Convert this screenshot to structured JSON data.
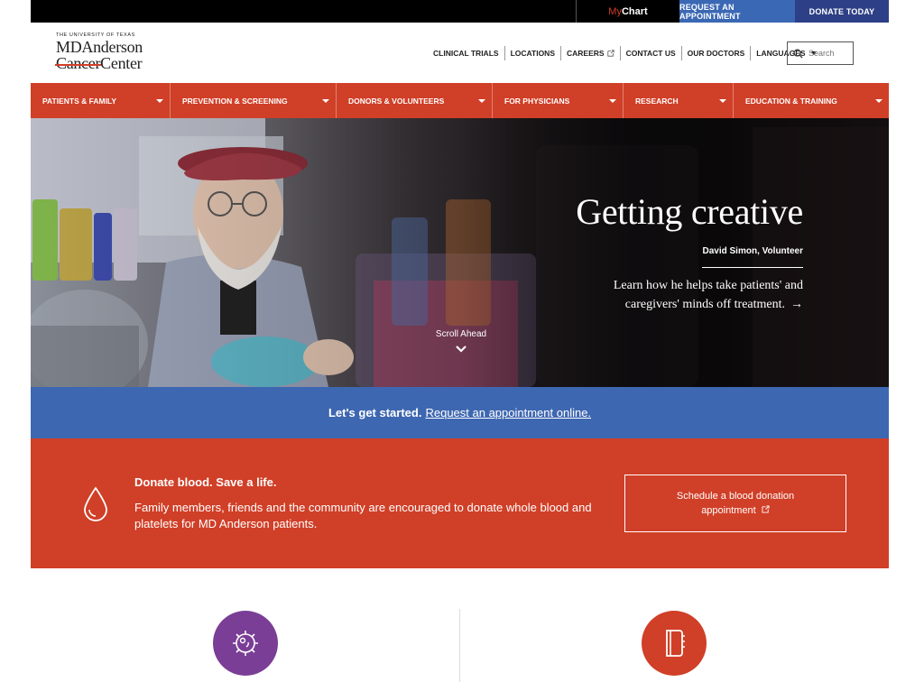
{
  "utility_bar": {
    "mychart_prefix": "My",
    "mychart_label": "Chart",
    "request_label": "REQUEST AN APPOINTMENT",
    "donate_label": "DONATE TODAY",
    "colors": {
      "bar": "#000000",
      "request": "#3b68b4",
      "donate": "#2d3f86"
    }
  },
  "logo": {
    "university": "THE UNIVERSITY OF TEXAS",
    "line1": "MDAnderson",
    "line2_struck": "Cancer",
    "line2": "Center"
  },
  "top_nav": {
    "items": [
      {
        "label": "CLINICAL TRIALS"
      },
      {
        "label": "LOCATIONS"
      },
      {
        "label": "CAREERS",
        "icon": "external-link-icon"
      },
      {
        "label": "CONTACT US"
      },
      {
        "label": "OUR DOCTORS"
      },
      {
        "label": "LANGUAGES",
        "icon": "caret-down-icon"
      }
    ],
    "search_placeholder": "Search"
  },
  "main_nav": {
    "color": "#d03f27",
    "items": [
      {
        "label": "PATIENTS & FAMILY"
      },
      {
        "label": "PREVENTION & SCREENING"
      },
      {
        "label": "DONORS & VOLUNTEERS"
      },
      {
        "label": "FOR PHYSICIANS"
      },
      {
        "label": "RESEARCH"
      },
      {
        "label": "EDUCATION & TRAINING"
      }
    ]
  },
  "hero": {
    "title": "Getting creative",
    "credit": "David Simon, Volunteer",
    "description": "Learn how he helps take patients' and caregivers' minds off treatment.",
    "arrow": "→",
    "scroll_label": "Scroll Ahead"
  },
  "cta_strip": {
    "lead": "Let's get started.",
    "link": "Request an appointment online.",
    "color": "#3e67b1"
  },
  "donate": {
    "title": "Donate blood. Save a life.",
    "body": "Family members, friends and the community are encouraged to donate whole blood and platelets for MD Anderson patients.",
    "button_line1": "Schedule a blood donation",
    "button_line2": "appointment",
    "icon": "blood-drop-icon"
  },
  "cards": [
    {
      "icon": "cell-icon",
      "color": "#7a3e96"
    },
    {
      "icon": "document-icon",
      "color": "#d03f27"
    }
  ]
}
